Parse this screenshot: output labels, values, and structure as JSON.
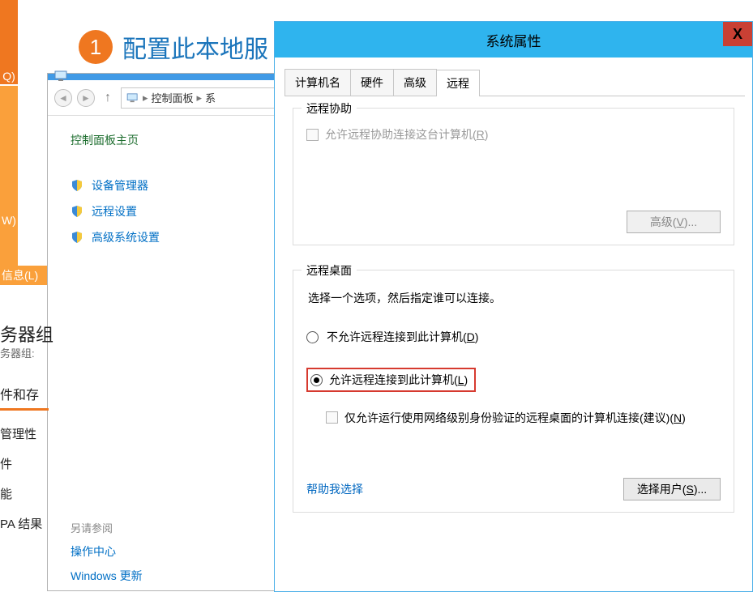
{
  "leftStrip": {
    "q": "Q)",
    "w": "W)",
    "x": "信息(L)"
  },
  "header": {
    "number": "1",
    "title": "配置此本地服"
  },
  "explorer": {
    "breadcrumb": {
      "root": "控制面板",
      "sep": "▸",
      "tail": "系"
    },
    "cpTitle": "控制面板主页",
    "links": {
      "devmgr": "设备管理器",
      "remote": "远程设置",
      "advanced": "高级系统设置"
    },
    "seeAlso": "另请参阅",
    "seeAlsoLinks": {
      "action": "操作中心",
      "wu": "Windows 更新"
    }
  },
  "frags": {
    "groupTitle": "务器组",
    "groupSub": "务器组: ",
    "secTitle": "件和存",
    "items": [
      "管理性",
      "件",
      "能",
      "PA 结果"
    ]
  },
  "dialog": {
    "title": "系统属性",
    "close": "X",
    "tabs": {
      "name": "计算机名",
      "hw": "硬件",
      "adv": "高级",
      "remote": "远程"
    },
    "group1": {
      "legend": "远程协助",
      "checkbox": "允许远程协助连接这台计算机(",
      "checkboxKey": "R",
      "advancedBtn": "高级(",
      "advancedKey": "V",
      "advancedTail": ")..."
    },
    "group2": {
      "legend": "远程桌面",
      "desc": "选择一个选项，然后指定谁可以连接。",
      "radio1": "不允许远程连接到此计算机(",
      "radio1Key": "D",
      "radio2": "允许远程连接到此计算机(",
      "radio2Key": "L",
      "cb2a": "仅允许运行使用网络级别身份验证的远程桌面的计算机连接(建议)(",
      "cb2Key": "N",
      "helpLink": "帮助我选择",
      "selectBtn": "选择用户(",
      "selectKey": "S",
      "selectTail": ")..."
    }
  }
}
